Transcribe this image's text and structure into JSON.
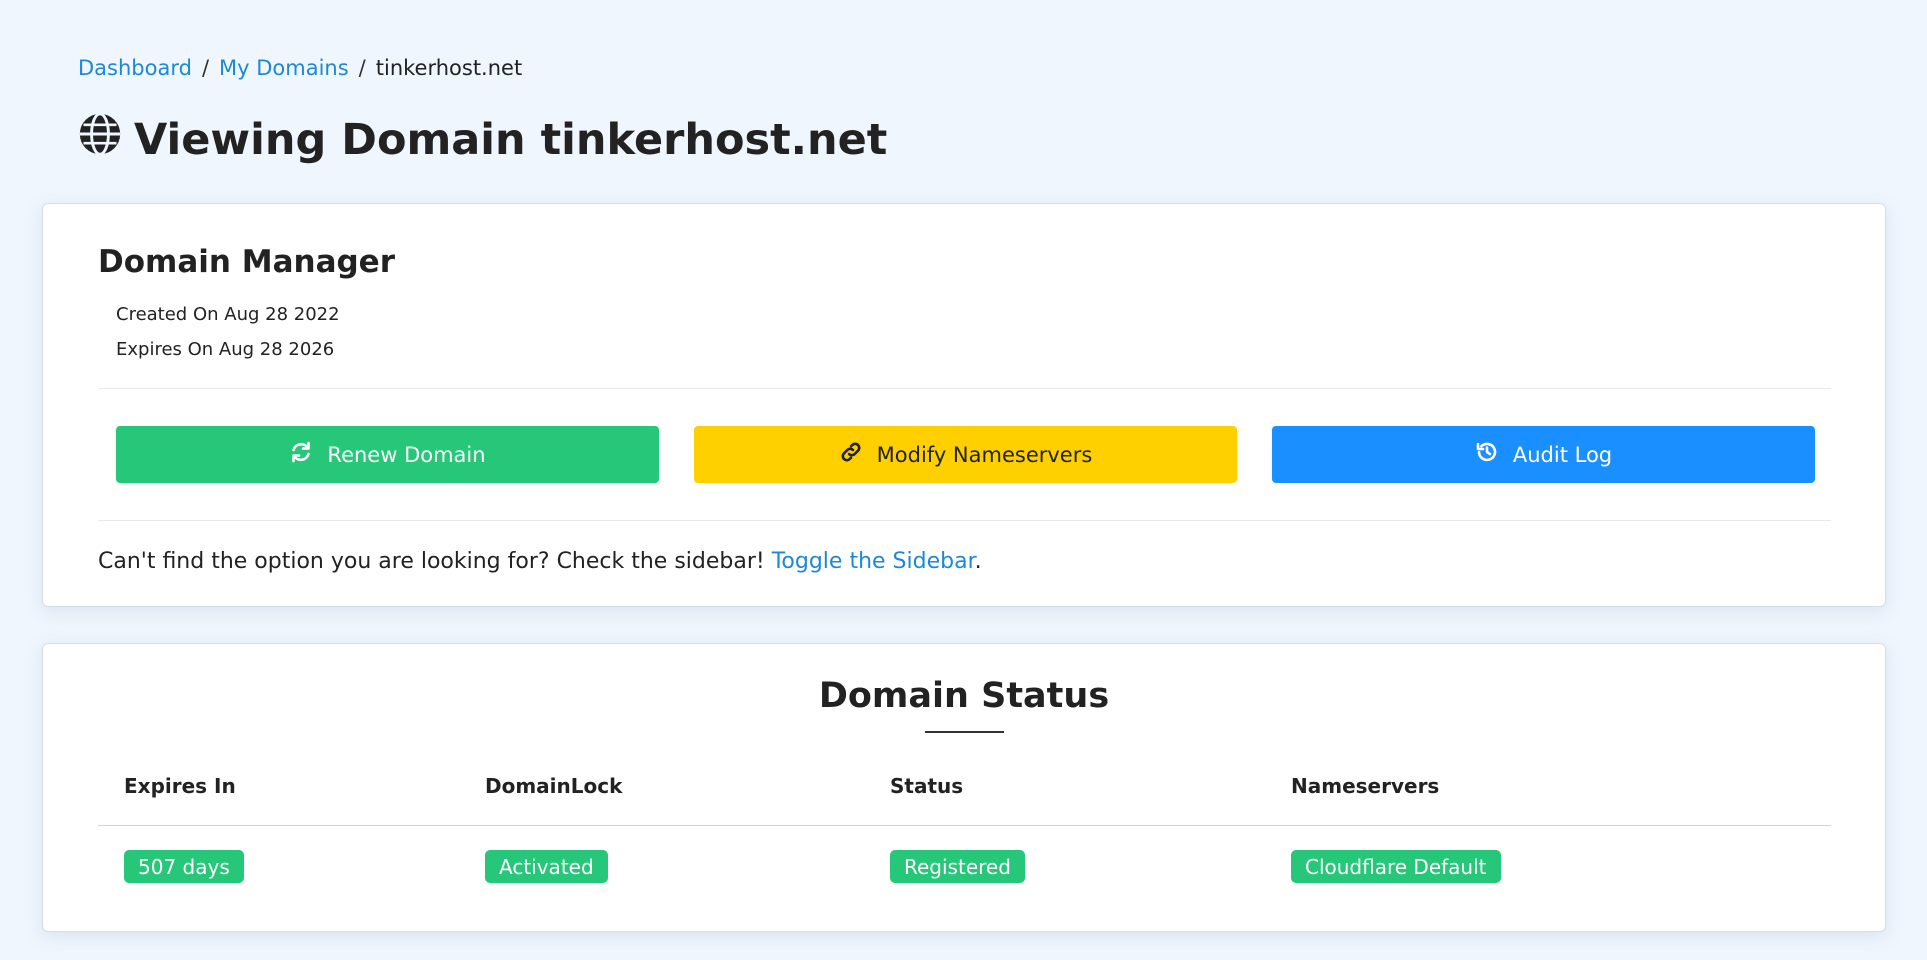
{
  "breadcrumb": {
    "items": [
      {
        "label": "Dashboard"
      },
      {
        "label": "My Domains"
      }
    ],
    "separator": "/",
    "current": "tinkerhost.net"
  },
  "page": {
    "title": "Viewing Domain tinkerhost.net",
    "title_icon": "globe-icon"
  },
  "manager": {
    "title": "Domain Manager",
    "created": "Created On Aug 28 2022",
    "expires": "Expires On Aug 28 2026",
    "buttons": {
      "renew": {
        "label": "Renew Domain",
        "icon": "refresh-icon",
        "color": "#27c77a"
      },
      "nameservers": {
        "label": "Modify Nameservers",
        "icon": "link-icon",
        "color": "#ffd000"
      },
      "audit": {
        "label": "Audit Log",
        "icon": "history-icon",
        "color": "#1a8fff"
      }
    },
    "help_text": "Can't find the option you are looking for? Check the sidebar!",
    "help_link": "Toggle the Sidebar",
    "help_suffix": "."
  },
  "status": {
    "title": "Domain Status",
    "columns": [
      "Expires In",
      "DomainLock",
      "Status",
      "Nameservers"
    ],
    "values": [
      "507 days",
      "Activated",
      "Registered",
      "Cloudflare Default"
    ],
    "badge_color": "#27c77a"
  },
  "colors": {
    "link": "#1e88d6",
    "background": "#eff6fe"
  }
}
